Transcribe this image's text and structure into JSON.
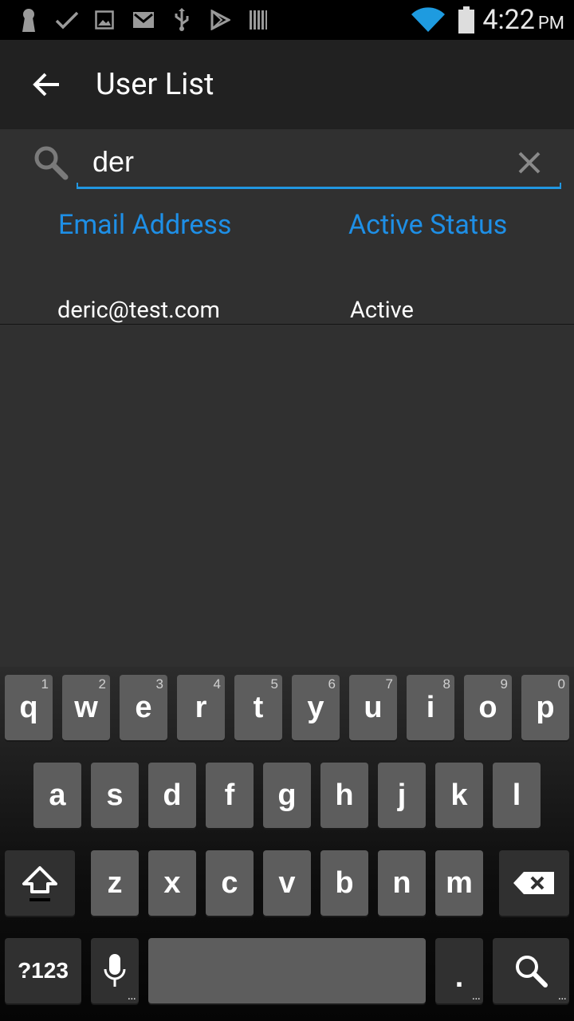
{
  "status_bar": {
    "time": "4:22",
    "ampm": "PM",
    "icons": [
      "keyhole-icon",
      "check-icon",
      "image-icon",
      "mail-icon",
      "usb-icon",
      "play-store-icon",
      "barcode-icon",
      "wifi-icon",
      "battery-icon"
    ]
  },
  "action_bar": {
    "title": "User List"
  },
  "search": {
    "value": "der"
  },
  "table": {
    "headers": [
      "Email Address",
      "Active Status"
    ],
    "rows": [
      [
        "deric@test.com",
        "Active"
      ]
    ]
  },
  "keyboard": {
    "row1": [
      "q",
      "w",
      "e",
      "r",
      "t",
      "y",
      "u",
      "i",
      "o",
      "p"
    ],
    "row1_hints": [
      "1",
      "2",
      "3",
      "4",
      "5",
      "6",
      "7",
      "8",
      "9",
      "0"
    ],
    "row2": [
      "a",
      "s",
      "d",
      "f",
      "g",
      "h",
      "j",
      "k",
      "l"
    ],
    "row3": [
      "z",
      "x",
      "c",
      "v",
      "b",
      "n",
      "m"
    ],
    "symbols_label": "?123",
    "period_label": ".",
    "more_dots": "..."
  },
  "colors": {
    "accent": "#1e8fe6",
    "underline": "#2196e0",
    "background": "#303030",
    "action_bar": "#212121"
  }
}
